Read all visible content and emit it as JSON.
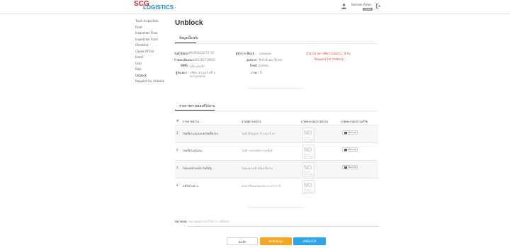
{
  "header": {
    "logo_top": "SCG",
    "logo_bottom": "LOGISTICS",
    "user_name": "Somsak Amon",
    "user_badge": "ADMIN",
    "icons": {
      "user": "user-icon",
      "logout": "logout-icon"
    },
    "colors": {
      "logo_red": "#d6242b",
      "logo_blue": "#1a8ac9"
    }
  },
  "sidebar": {
    "items": [
      {
        "label": "Truck Inspection"
      },
      {
        "label": "Fleet"
      },
      {
        "label": "Inspection Flow"
      },
      {
        "label": "Inspection Form"
      },
      {
        "label": "Checklist"
      },
      {
        "label": "Cause Of Fail"
      },
      {
        "label": "Email"
      },
      {
        "label": "User"
      },
      {
        "label": "Role"
      },
      {
        "label": "Unblock"
      },
      {
        "label": "Request For Unblock"
      }
    ],
    "active": "Unblock"
  },
  "page": {
    "title": "Unblock"
  },
  "info_tab": {
    "label": "ข้อมูลเบื้องต้น"
  },
  "info": {
    "block_date_label": "วันที่ Block :",
    "block_date_value": "09/29/2016 12:39",
    "plate_label": "ป้ายทะเบียนรถ :",
    "plate_value": "สบ83100719830",
    "wms_label": "WMS :",
    "wms_value": "สุนิต แกมป่ำ",
    "blocker_label": "ผู้ทำการ Block :",
    "blocker_value": "แสนคุณพ",
    "dept_label": "จุดตรวจ :",
    "dept_value": "ยิ่งยิ่งน้ำมัน (ดีเซล)",
    "fleet_label": "Fleet :",
    "fleet_value": "Safety...",
    "color_label": "ภาค :",
    "color_value": "ไร้",
    "owner_label": "ผู้รับเหมา :",
    "owner_value_1": "บริษัท เอาเจอร์ พรีโล",
    "owner_value_2": "ทรานสปอร์ต",
    "count_label": "จำนวนรายการที่ตรวจไม่ผ่าน : 4 ข้อ",
    "request_label": "Request For Unblock : -"
  },
  "fail_tab": {
    "label": "รายการตรวจสอบที่ไม่ผ่าน"
  },
  "table": {
    "headers": [
      "#",
      "รายการตรวจ",
      "สาเหตุการตรวจ",
      "ภาพประกอบการตรวจ",
      "ภาพประกอบการแก้ไข"
    ],
    "rows": [
      {
        "no": "1",
        "item": "ไฟเลี้ยวรถและแสงไฟเลี้ยวรถ",
        "cause": "ไม่มี Stopper จำนวน 4 ตัว",
        "photo_main": "NO",
        "photo_sub": "PHOTO\nAVAILABLE",
        "upload": "เลือกภาพ"
      },
      {
        "no": "2",
        "item": "ไฟเลี้ยวหลังเลน",
        "cause": "ไม่มีการแบ่งพักตามหนี้เท้า",
        "photo_main": "NO",
        "photo_sub": "PHOTO\nAVAILABLE",
        "upload": "เลือกภาพ"
      },
      {
        "no": "3",
        "item": "ไฟบอกท้ายหลัก Safety",
        "cause": "ไม่พบยาเคมี พร้อมใช้งาน",
        "photo_main": "NO",
        "photo_sub": "PHOTO\nAVAILABLE",
        "upload": "เลือกภาพ"
      },
      {
        "no": "4",
        "item": "แพ้ไฟไม่ผ่าน",
        "cause": "ยอระจรีผมมขอบตอง มากกว่า 6",
        "photo_main": "NO",
        "photo_sub": "PHOTO\nAVAILABLE",
        "upload": "เลือกภาพ"
      }
    ]
  },
  "remark": {
    "label": "หมายเหตุ :",
    "placeholder": "หมายเหตุการแก้ไขการ unblock"
  },
  "buttons": {
    "cancel": "ยกเลิก",
    "save": "บันทึกข้อมูล",
    "unblock": "UNBLOCK"
  },
  "colors": {
    "accent_orange": "#f5a623",
    "accent_blue": "#2aa5e8",
    "alert_red": "#e2322d"
  }
}
